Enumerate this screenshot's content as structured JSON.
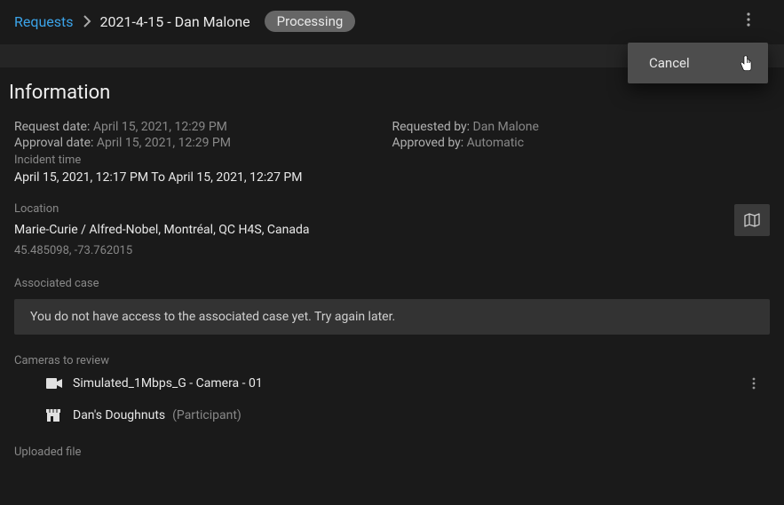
{
  "breadcrumb": {
    "root": "Requests",
    "current": "2021-4-15 - Dan Malone"
  },
  "status": "Processing",
  "menu": {
    "cancel": "Cancel"
  },
  "section_title": "Information",
  "info": {
    "request_date_label": "Request date:",
    "request_date_value": "April 15, 2021, 12:29 PM",
    "approval_date_label": "Approval date:",
    "approval_date_value": "April 15, 2021, 12:29 PM",
    "incident_time_label": "Incident time",
    "incident_time_value": "April 15, 2021, 12:17 PM To April 15, 2021, 12:27 PM",
    "requested_by_label": "Requested by:",
    "requested_by_value": "Dan Malone",
    "approved_by_label": "Approved by:",
    "approved_by_value": "Automatic"
  },
  "location": {
    "label": "Location",
    "address": "Marie-Curie / Alfred-Nobel, Montréal, QC H4S, Canada",
    "coords": "45.485098, -73.762015"
  },
  "associated_case": {
    "label": "Associated case",
    "message": "You do not have access to the associated case yet. Try again later."
  },
  "cameras": {
    "label": "Cameras to review",
    "items": [
      {
        "name": "Simulated_1Mbps_G - Camera - 01",
        "participant": ""
      },
      {
        "name": "Dan's Doughnuts",
        "participant": "(Participant)"
      }
    ]
  },
  "uploaded": {
    "label": "Uploaded file"
  }
}
